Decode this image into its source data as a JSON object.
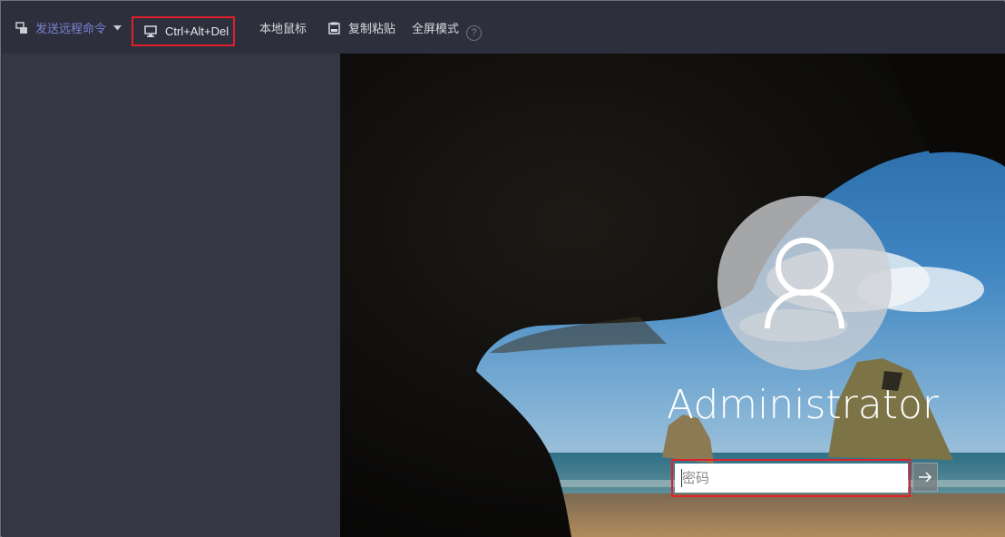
{
  "toolbar": {
    "send_remote_command": "发送远程命令",
    "ctrl_alt_del": "Ctrl+Alt+Del",
    "local_mouse": "本地鼠标",
    "copy_paste": "复制粘贴",
    "fullscreen": "全屏模式",
    "help": "?"
  },
  "login": {
    "username": "Administrator",
    "password_placeholder": "密码"
  },
  "colors": {
    "accent": "#7b83d6",
    "highlight_border": "#e0212b",
    "toolbar_bg": "#2d2f3c",
    "sidebar_bg": "#353745"
  }
}
